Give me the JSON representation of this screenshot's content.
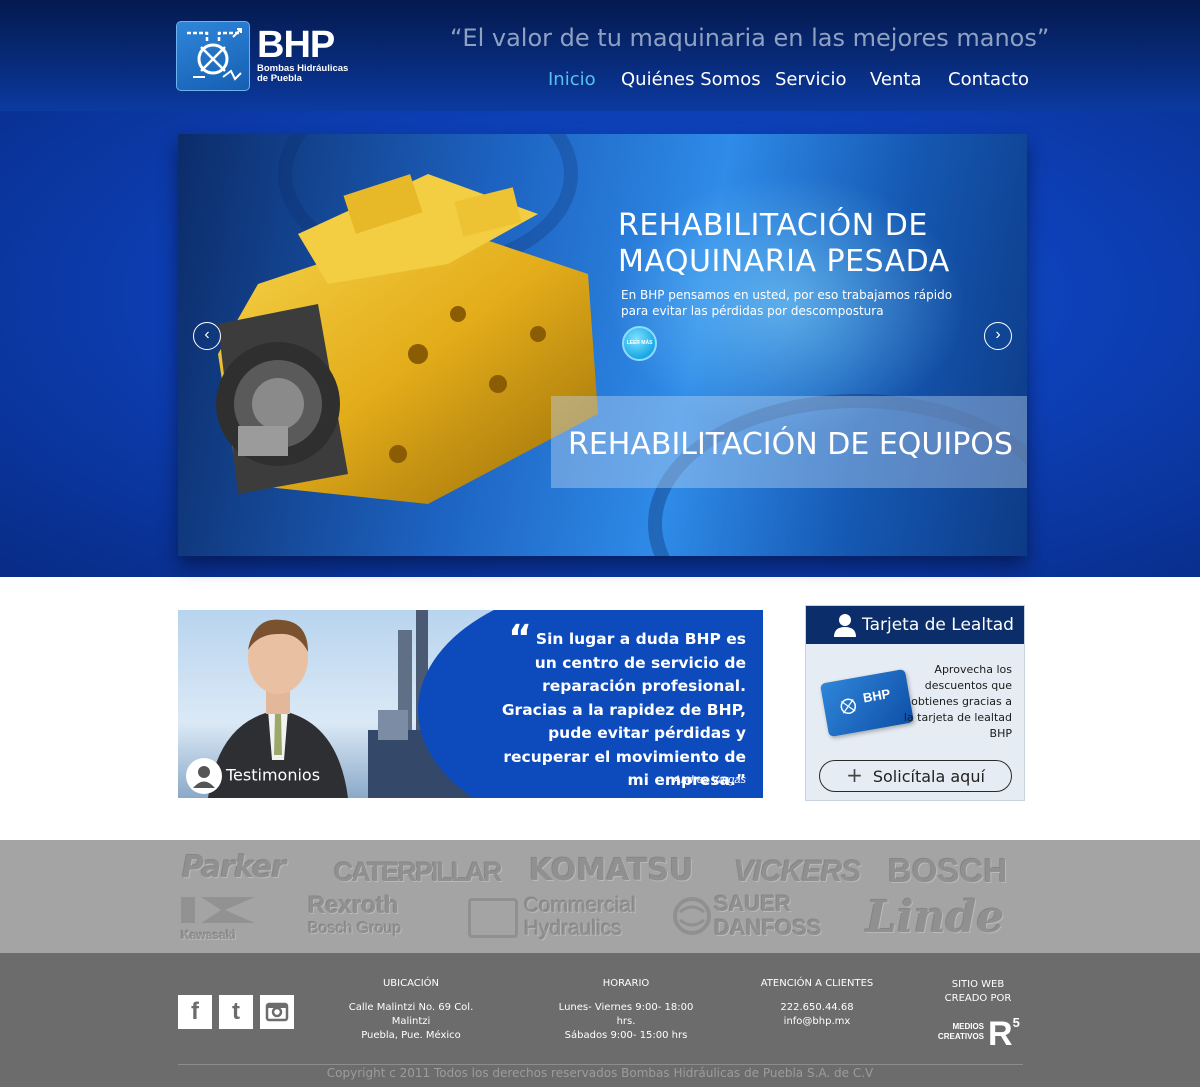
{
  "header": {
    "logo_title": "BHP",
    "logo_subtitle_1": "Bombas Hidráulicas",
    "logo_subtitle_2": "de Puebla",
    "slogan": "“El valor de tu maquinaria  en las mejores manos”",
    "nav": [
      {
        "label": "Inicio",
        "active": true
      },
      {
        "label": "Quiénes Somos",
        "active": false
      },
      {
        "label": "Servicio",
        "active": false
      },
      {
        "label": "Venta",
        "active": false
      },
      {
        "label": "Contacto",
        "active": false
      }
    ],
    "active_color": "#56c3ec"
  },
  "hero": {
    "title_line1": "REHABILITACIÓN DE",
    "title_line2": "MAQUINARIA PESADA",
    "text": "En BHP pensamos en usted, por eso trabajamos rápido para evitar las pérdidas por descompostura",
    "more_button": "LEER MÁS",
    "banner": "REHABILITACIÓN DE EQUIPOS",
    "prev_icon": "chevron-left-icon",
    "next_icon": "chevron-right-icon"
  },
  "testimonial": {
    "quote": "Sin lugar a duda BHP es un centro de servicio de reparación profesional. Gracias a la rapidez de BHP, pude evitar pérdidas y recuperar el movimiento de mi empresa.”",
    "author": "Andres Vargas",
    "label": "Testimonios"
  },
  "loyalty": {
    "title": "Tarjeta de Lealtad",
    "text": "Aprovecha los descuentos que obtienes gracias a la tarjeta de lealtad BHP",
    "card_label": "BHP",
    "button": "Solicítala aquí"
  },
  "brands": {
    "parker": "Parker",
    "caterpillar": "CATERPILLAR",
    "komatsu": "KOMATSU",
    "vickers": "VICKERS",
    "bosch": "BOSCH",
    "kawasaki": "Kawasaki",
    "rexroth": "Rexroth",
    "rexroth_sub": "Bosch Group",
    "commercial": "Commercial",
    "commercial_sub": "Hydraulics",
    "sauer": "SAUER",
    "danfoss": "DANFOSS",
    "linde": "Linde"
  },
  "footer": {
    "social": [
      "facebook-icon",
      "twitter-icon",
      "instagram-icon"
    ],
    "ubicacion_title": "UBICACIÓN",
    "ubicacion_line1": "Calle Malintzi No. 69 Col. Malintzi",
    "ubicacion_line2": "Puebla, Pue. México",
    "horario_title": "HORARIO",
    "horario_line1": "Lunes- Viernes 9:00- 18:00 hrs.",
    "horario_line2": "Sábados 9:00- 15:00 hrs",
    "atencion_title": "ATENCIÓN A CLIENTES",
    "phone": "222.650.44.68",
    "email": "info@bhp.mx",
    "credit_line1": "SITIO WEB",
    "credit_line2": "CREADO POR",
    "credit_brand1": "MEDIOS",
    "credit_brand2": "CREATIVOS",
    "credit_logo": "R",
    "credit_logo_sup": "5",
    "copyright": "Copyright c 2011 Todos los derechos reservados Bombas Hidráulicas de Puebla S.A. de C.V"
  }
}
